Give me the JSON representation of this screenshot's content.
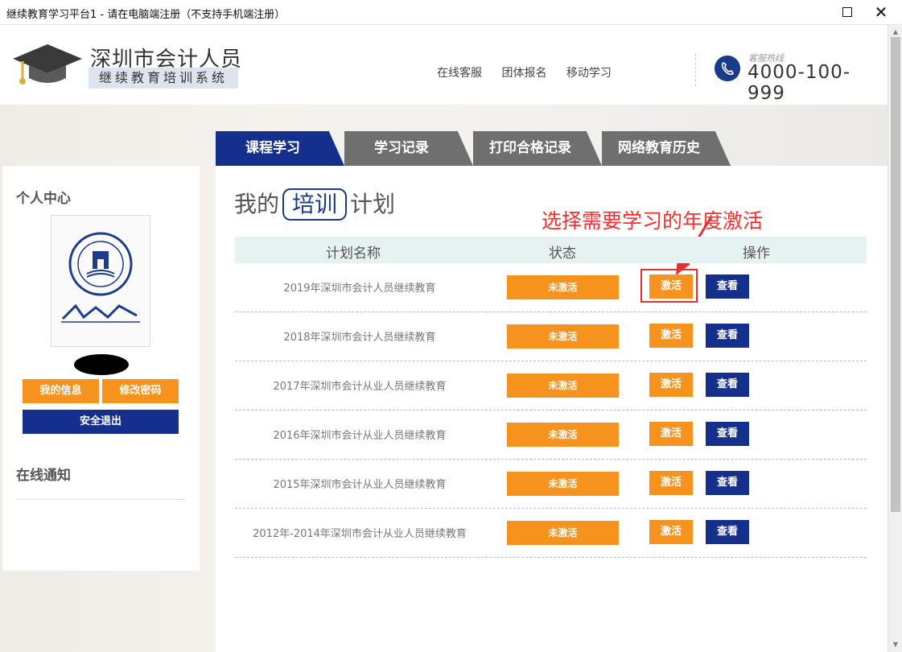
{
  "window": {
    "title": "继续教育学习平台1 - 请在电脑端注册（不支持手机端注册）"
  },
  "header": {
    "brand_title": "深圳市会计人员",
    "brand_subtitle": "继续教育培训系统",
    "nav": [
      "在线客服",
      "团体报名",
      "移动学习"
    ],
    "hotline_label": "客服热线",
    "hotline_number": "4000-100-999"
  },
  "tabs": [
    {
      "label": "课程学习",
      "active": true
    },
    {
      "label": "学习记录",
      "active": false
    },
    {
      "label": "打印合格记录",
      "active": false
    },
    {
      "label": "网络教育历史",
      "active": false
    }
  ],
  "sidebar": {
    "heading": "个人中心",
    "buttons": {
      "my_info": "我的信息",
      "change_password": "修改密码",
      "logout": "安全退出"
    },
    "notice_heading": "在线通知"
  },
  "main": {
    "title_before": "我的",
    "title_boxed": "培训",
    "title_after": "计划",
    "annotation": "选择需要学习的年度激活",
    "columns": [
      "计划名称",
      "状态",
      "操作"
    ],
    "rows": [
      {
        "name": "2019年深圳市会计人员继续教育",
        "status": "未激活",
        "activate": "激活",
        "view": "查看"
      },
      {
        "name": "2018年深圳市会计人员继续教育",
        "status": "未激活",
        "activate": "激活",
        "view": "查看"
      },
      {
        "name": "2017年深圳市会计从业人员继续教育",
        "status": "未激活",
        "activate": "激活",
        "view": "查看"
      },
      {
        "name": "2016年深圳市会计从业人员继续教育",
        "status": "未激活",
        "activate": "激活",
        "view": "查看"
      },
      {
        "name": "2015年深圳市会计从业人员继续教育",
        "status": "未激活",
        "activate": "激活",
        "view": "查看"
      },
      {
        "name": "2012年-2014年深圳市会计从业人员继续教育",
        "status": "未激活",
        "activate": "激活",
        "view": "查看"
      }
    ]
  },
  "colors": {
    "navy": "#15308c",
    "orange": "#f5931e",
    "annotation_red": "#ff2b2b",
    "tab_inactive": "#6f6f6f"
  },
  "icons": [
    "graduation-cap-icon",
    "phone-icon",
    "maximize-icon",
    "close-icon",
    "university-seal-icon",
    "arrow-icon"
  ]
}
